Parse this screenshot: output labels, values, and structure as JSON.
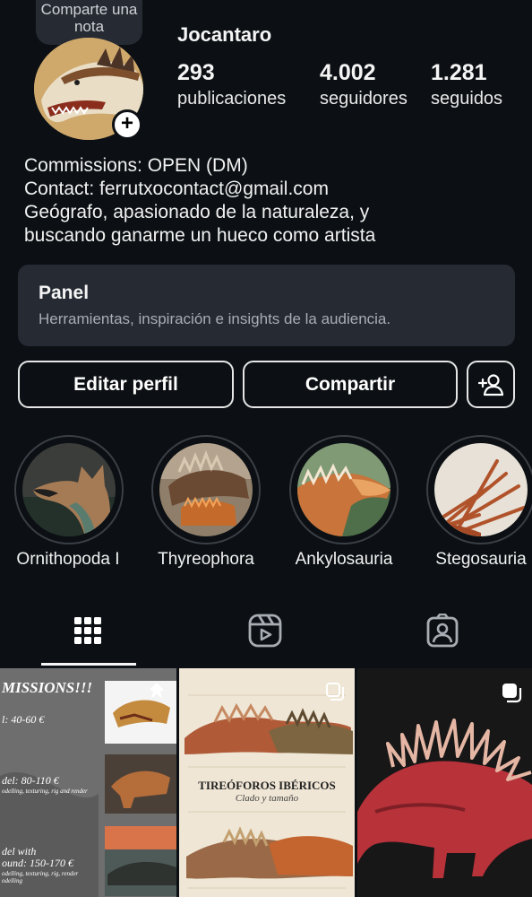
{
  "profile": {
    "note_bubble": "Comparte una nota",
    "username": "Jocantaro",
    "stats": {
      "posts_count": "293",
      "posts_label": "publicaciones",
      "followers_count": "4.002",
      "followers_label": "seguidores",
      "following_count": "1.281",
      "following_label": "seguidos"
    },
    "bio": [
      "Commissions: OPEN (DM)",
      "Contact: ferrutxocontact@gmail.com",
      "Geógrafo, apasionado de la naturaleza, y",
      "buscando ganarme un hueco como artista"
    ]
  },
  "panel": {
    "title": "Panel",
    "subtitle": "Herramientas, inspiración e insights de la audiencia."
  },
  "actions": {
    "edit_label": "Editar perfil",
    "share_label": "Compartir"
  },
  "highlights": [
    {
      "label": "Ornithopoda I"
    },
    {
      "label": "Thyreophora"
    },
    {
      "label": "Ankylosauria"
    },
    {
      "label": "Stegosauria"
    }
  ],
  "tabs": {
    "active": "grid",
    "icons": [
      "grid-icon",
      "reels-icon",
      "tagged-icon"
    ]
  },
  "posts": [
    {
      "title": "MISSIONS!!!",
      "lines": [
        "l: 40-60 €",
        "del: 80-110 €",
        "odelling, texturing, rig and render",
        "del with",
        "ound: 150-170 €",
        "odelling, texturing, rig, render",
        "odelling"
      ]
    },
    {
      "title": "TIREÓFOROS IBÉRICOS",
      "subtitle": "Clado y tamaño"
    },
    {}
  ],
  "colors": {
    "background": "#0c1014",
    "panel": "#262b33",
    "text": "#f5f5f5",
    "muted": "#a8adb4"
  }
}
